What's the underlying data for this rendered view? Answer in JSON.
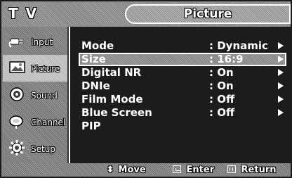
{
  "header": {
    "title_left": "T V",
    "title_center": "Picture"
  },
  "sidebar": {
    "items": [
      {
        "label": "Input",
        "icon": "input-plug-icon",
        "active": false
      },
      {
        "label": "Picture",
        "icon": "picture-icon",
        "active": true
      },
      {
        "label": "Sound",
        "icon": "sound-speaker-icon",
        "active": false
      },
      {
        "label": "Channel",
        "icon": "channel-dish-icon",
        "active": false
      },
      {
        "label": "Setup",
        "icon": "setup-gear-icon",
        "active": false
      }
    ]
  },
  "menu": {
    "rows": [
      {
        "name": "Mode",
        "value": ": Dynamic",
        "has_arrow": true
      },
      {
        "name": "Size",
        "value": ": 16:9",
        "has_arrow": true,
        "selected": true
      },
      {
        "name": "Digital NR",
        "value": ": On",
        "has_arrow": true
      },
      {
        "name": "DNIe",
        "value": ": On",
        "has_arrow": true
      },
      {
        "name": "Film Mode",
        "value": ": Off",
        "has_arrow": true
      },
      {
        "name": "Blue Screen",
        "value": ": Off",
        "has_arrow": true
      },
      {
        "name": "PIP",
        "value": "",
        "has_arrow": false
      }
    ]
  },
  "footer": {
    "move": "Move",
    "enter": "Enter",
    "return": "Return"
  },
  "colors": {
    "menu_background": "#1c1c1c",
    "text": "#ffffff",
    "frame": "#1a1a1a"
  }
}
